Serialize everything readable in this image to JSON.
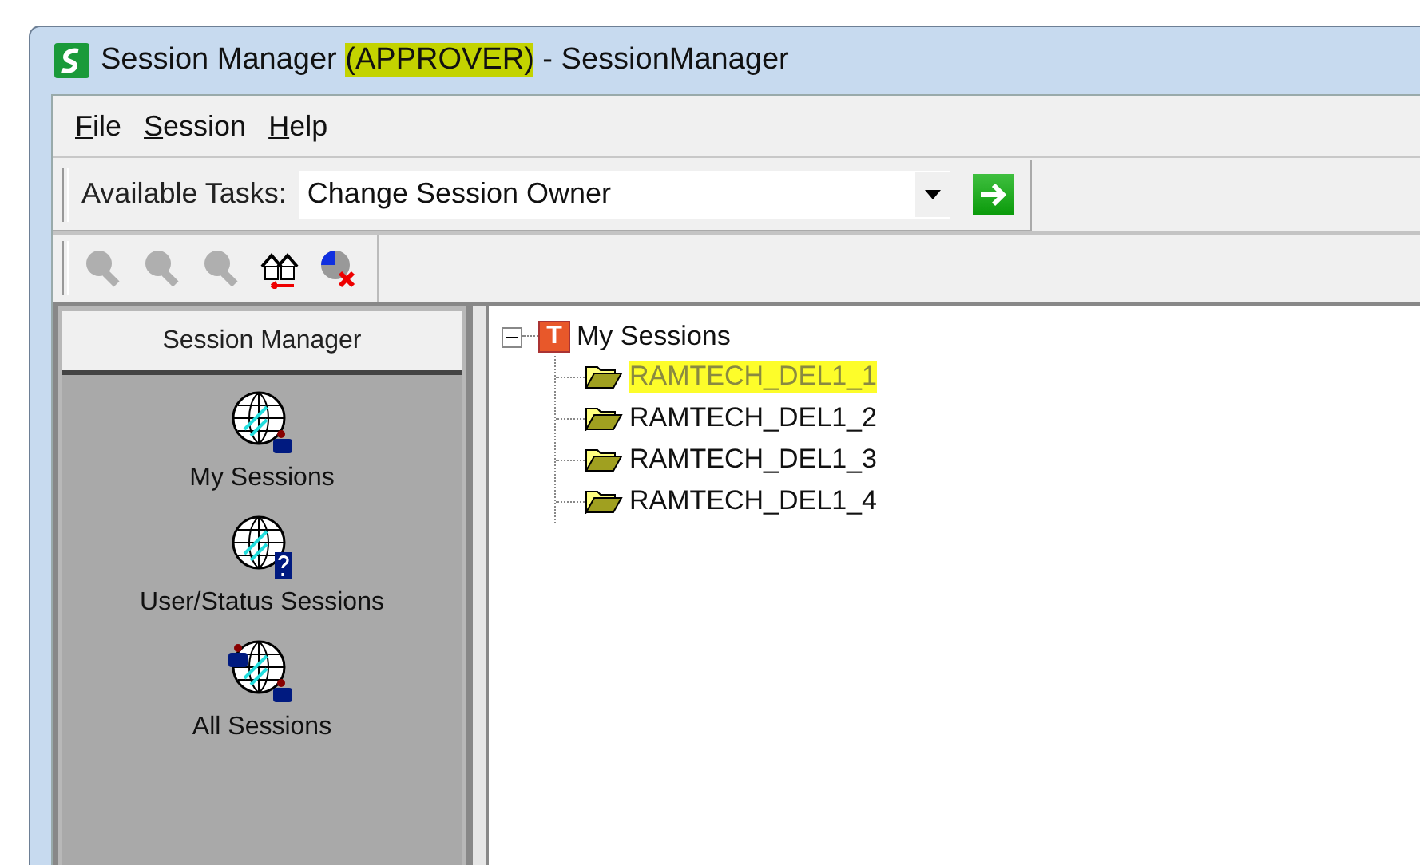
{
  "window": {
    "title_parts": [
      {
        "text": "Session Manager ",
        "highlighted": false
      },
      {
        "text": "(APPROVER)",
        "highlighted": true
      },
      {
        "text": " - SessionManager",
        "highlighted": false
      }
    ]
  },
  "menu": [
    {
      "mnemonic": "F",
      "rest": "ile"
    },
    {
      "mnemonic": "S",
      "rest": "ession"
    },
    {
      "mnemonic": "H",
      "rest": "elp"
    }
  ],
  "task_bar": {
    "label": "Available Tasks:",
    "value": "Change Session Owner"
  },
  "toolbar": [
    {
      "kind": "zoom",
      "disabled": true
    },
    {
      "kind": "zoom",
      "disabled": true
    },
    {
      "kind": "zoom",
      "disabled": true
    },
    {
      "kind": "houses",
      "disabled": false
    },
    {
      "kind": "pie-remove",
      "disabled": false
    }
  ],
  "sidebar": {
    "title": "Session Manager",
    "items": [
      {
        "kind": "mine",
        "label": "My Sessions"
      },
      {
        "kind": "query",
        "label": "User/Status Sessions"
      },
      {
        "kind": "all",
        "label": "All Sessions"
      }
    ]
  },
  "tree": {
    "label": "My Sessions",
    "icon_letter": "T",
    "expanded": true,
    "children": [
      {
        "label": "RAMTECH_DEL1_1",
        "highlighted": true
      },
      {
        "label": "RAMTECH_DEL1_2",
        "highlighted": false
      },
      {
        "label": "RAMTECH_DEL1_3",
        "highlighted": false
      },
      {
        "label": "RAMTECH_DEL1_4",
        "highlighted": false
      }
    ]
  }
}
